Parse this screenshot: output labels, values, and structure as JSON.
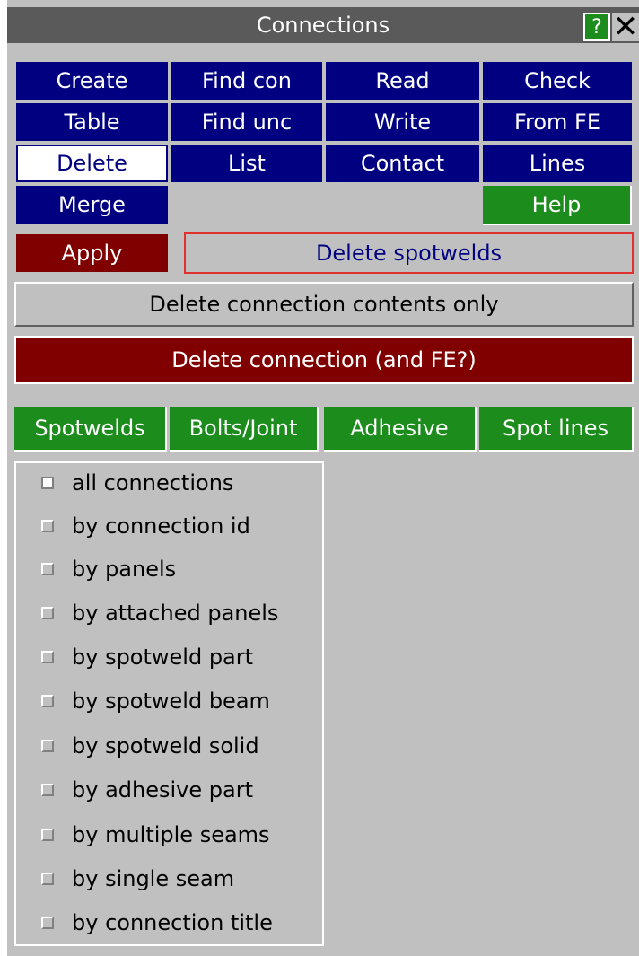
{
  "window": {
    "title": "Connections",
    "help_label": "?",
    "close_label": "✕"
  },
  "menu": {
    "create": "Create",
    "find_con": "Find con",
    "read": "Read",
    "check": "Check",
    "table": "Table",
    "find_unc": "Find unc",
    "write": "Write",
    "from_fe": "From FE",
    "delete": "Delete",
    "list": "List",
    "contact": "Contact",
    "lines": "Lines",
    "merge": "Merge",
    "help": "Help"
  },
  "delete_panel": {
    "apply": "Apply",
    "mode": "Delete spotwelds",
    "contents_only": "Delete connection contents only",
    "delete_connection": "Delete connection (and FE?)"
  },
  "type_tabs": [
    "Spotwelds",
    "Bolts/Joint",
    "Adhesive",
    "Spot lines"
  ],
  "options": [
    {
      "label": "all connections",
      "checked": true
    },
    {
      "label": "by connection id",
      "checked": false
    },
    {
      "label": "by panels",
      "checked": false
    },
    {
      "label": "by attached panels",
      "checked": false
    },
    {
      "label": "by spotweld part",
      "checked": false
    },
    {
      "label": "by spotweld beam",
      "checked": false
    },
    {
      "label": "by spotweld solid",
      "checked": false
    },
    {
      "label": "by adhesive part",
      "checked": false
    },
    {
      "label": "by multiple seams",
      "checked": false
    },
    {
      "label": "by single seam",
      "checked": false
    },
    {
      "label": "by connection title",
      "checked": false
    }
  ],
  "colors": {
    "navy": "#000080",
    "green": "#1c8c1c",
    "maroon": "#800000",
    "panel": "#c0c0c0"
  }
}
